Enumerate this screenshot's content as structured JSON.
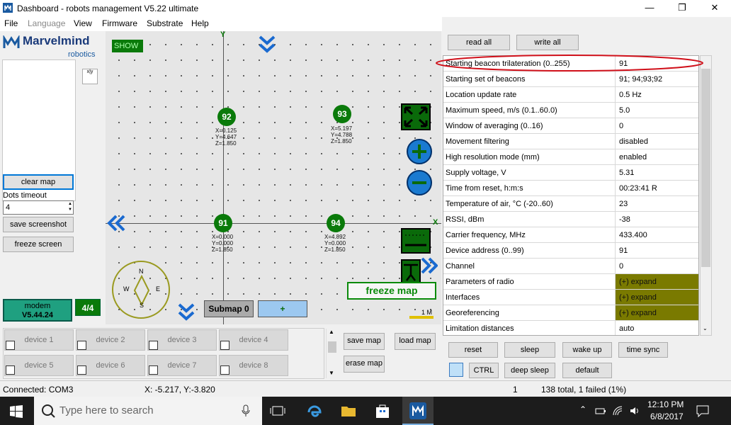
{
  "window": {
    "title": "Dashboard - robots management   V5.22   ultimate"
  },
  "menu": [
    "File",
    "Language",
    "View",
    "Firmware",
    "Substrate",
    "Help"
  ],
  "logo": {
    "name": "Marvelmind",
    "sub": "robotics"
  },
  "left": {
    "clear_map": "clear map",
    "dots_timeout_label": "Dots timeout",
    "dots_timeout_value": "4",
    "save_screenshot": "save screenshot",
    "freeze_screen": "freeze screen",
    "modem_label": "modem",
    "modem_version": "V5.44.24",
    "fraction": "4/4"
  },
  "map": {
    "show": "SHOW",
    "axis_y": "Y",
    "axis_x": "X",
    "beacons": [
      {
        "id": "92",
        "x": "X=0.125",
        "y": "Y=4.647",
        "z": "Z=1.850"
      },
      {
        "id": "93",
        "x": "X=5.197",
        "y": "Y=4.788",
        "z": "Z=1.850"
      },
      {
        "id": "91",
        "x": "X=0.000",
        "y": "Y=0.000",
        "z": "Z=1.850"
      },
      {
        "id": "94",
        "x": "X=4.892",
        "y": "Y=0.000",
        "z": "Z=1.850"
      }
    ],
    "compass": {
      "n": "N",
      "s": "S",
      "e": "E",
      "w": "W"
    },
    "freeze_map": "freeze map",
    "submap": "Submap 0",
    "plus": "+",
    "scale": "1 M"
  },
  "devices": {
    "row1": [
      "device 1",
      "device 2",
      "device 3",
      "device 4"
    ],
    "row2": [
      "device 5",
      "device 6",
      "device 7",
      "device 8"
    ],
    "save_map": "save map",
    "load_map": "load map",
    "erase_map": "erase map"
  },
  "right": {
    "read_all": "read all",
    "write_all": "write all",
    "properties": [
      {
        "name": "Starting beacon trilateration (0..255)",
        "value": "91"
      },
      {
        "name": "Starting set of beacons",
        "value": "91;  94;93;92"
      },
      {
        "name": "Location update rate",
        "value": "0.5 Hz"
      },
      {
        "name": "Maximum speed, m/s (0.1..60.0)",
        "value": "5.0"
      },
      {
        "name": "Window of averaging (0..16)",
        "value": "0"
      },
      {
        "name": "Movement filtering",
        "value": "disabled"
      },
      {
        "name": "High resolution mode (mm)",
        "value": "enabled"
      },
      {
        "name": "Supply voltage, V",
        "value": "5.31"
      },
      {
        "name": "Time from reset, h:m:s",
        "value": "00:23:41   R"
      },
      {
        "name": "Temperature of air, °C (-20..60)",
        "value": "23"
      },
      {
        "name": "RSSI, dBm",
        "value": "-38"
      },
      {
        "name": "Carrier frequency, MHz",
        "value": "433.400"
      },
      {
        "name": "Device address (0..99)",
        "value": "91"
      },
      {
        "name": "Channel",
        "value": "0"
      },
      {
        "name": "Parameters of radio",
        "value": "(+) expand",
        "expand": true
      },
      {
        "name": "Interfaces",
        "value": "(+) expand",
        "expand": true
      },
      {
        "name": "Georeferencing",
        "value": "(+) expand",
        "expand": true
      },
      {
        "name": "Limitation distances",
        "value": "auto"
      }
    ],
    "reset": "reset",
    "sleep": "sleep",
    "wake_up": "wake up",
    "time_sync": "time sync",
    "ctrl": "CTRL",
    "deep_sleep": "deep sleep",
    "default": "default"
  },
  "status": {
    "connected": "Connected: COM3",
    "coords": "X: -5.217, Y:-3.820",
    "count": "1",
    "total": "138 total, 1 failed (1%)"
  },
  "taskbar": {
    "search_placeholder": "Type here to search",
    "time": "12:10 PM",
    "date": "6/8/2017"
  },
  "colors": {
    "accent_green": "#0a7a0a",
    "expand_olive": "#7a7a00",
    "highlight_red": "#d0101a"
  }
}
